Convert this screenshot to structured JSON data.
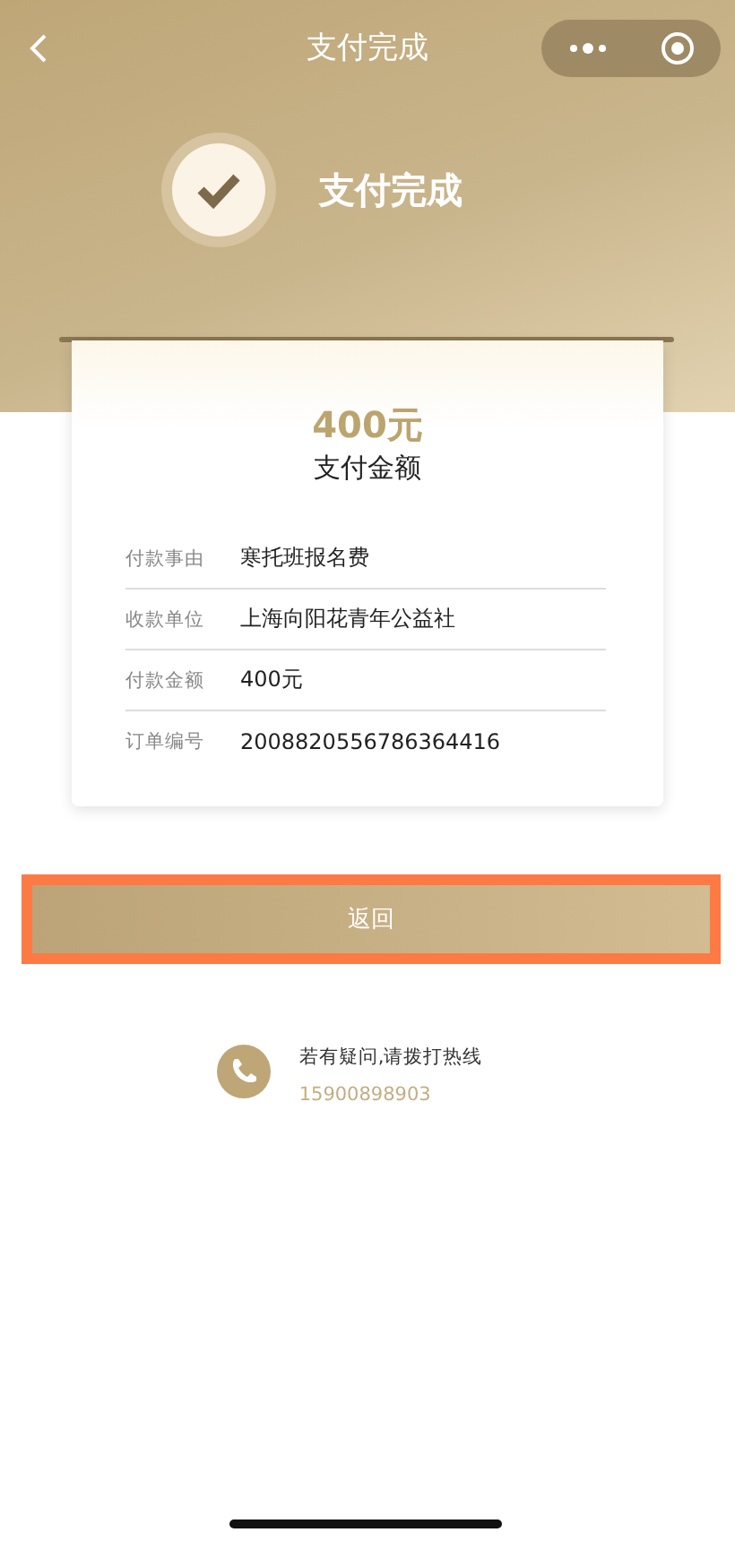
{
  "nav": {
    "title": "支付完成"
  },
  "status": {
    "title": "支付完成"
  },
  "summary": {
    "amount": "400元",
    "label": "支付金额"
  },
  "details": [
    {
      "label": "付款事由",
      "value": "寒托班报名费"
    },
    {
      "label": "收款单位",
      "value": "上海向阳花青年公益社"
    },
    {
      "label": "付款金额",
      "value": "400元"
    },
    {
      "label": "订单编号",
      "value": "2008820556786364416"
    }
  ],
  "back_button": {
    "label": "返回",
    "highlighted": true
  },
  "contact": {
    "text": "若有疑问,请拨打热线",
    "phone": "15900898903"
  }
}
